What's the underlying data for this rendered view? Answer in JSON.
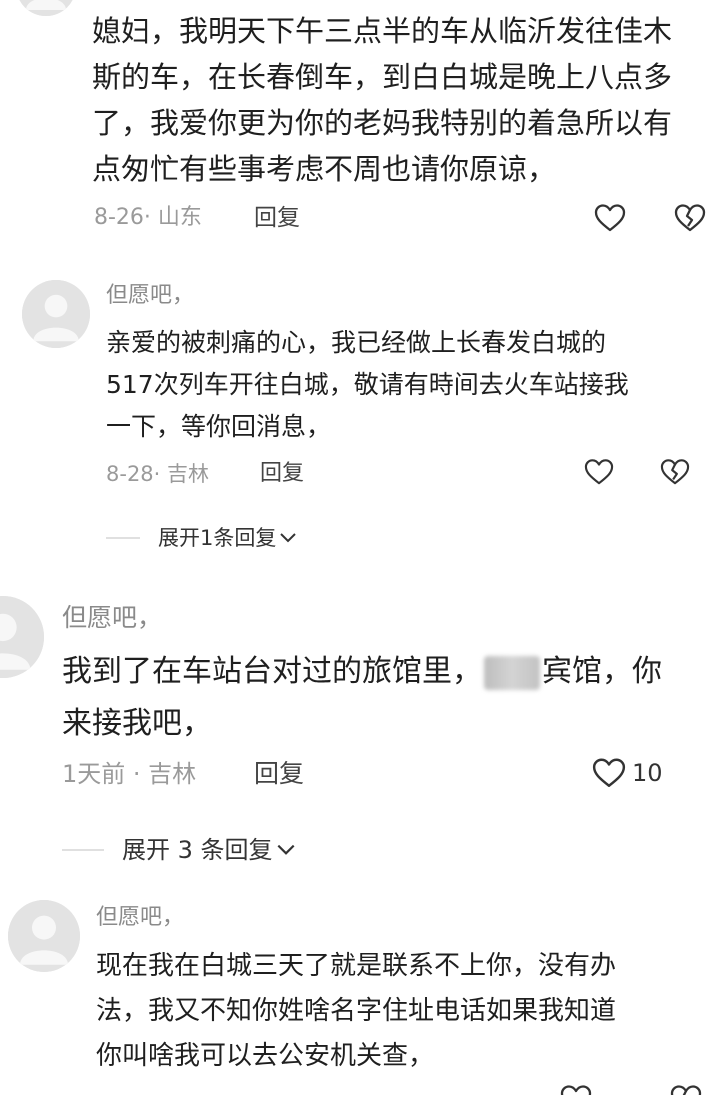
{
  "comments": [
    {
      "username": "",
      "content_lines": [
        "媳妇，我明天下午三点半的车从临沂发往佳木",
        "斯的车，在长春倒车，到白白城是晚上八点多",
        "了，我爱你更为你的老妈我特别的着急所以有",
        "点匆忙有些事考虑不周也请你原谅，"
      ],
      "meta": "8-26· 山东",
      "reply_label": "回复",
      "like_count": ""
    },
    {
      "username": "但愿吧，",
      "content_lines": [
        "亲爱的被刺痛的心，我已经做上长春发白城的",
        "517次列车开往白城，敬请有時间去火车站接我",
        "一下，等你回消息，"
      ],
      "meta": "8-28· 吉林",
      "reply_label": "回复",
      "like_count": "",
      "expand_label": "展开1条回复"
    },
    {
      "username": "但愿吧，",
      "content_lines": [
        "我到了在车站台对过的旅馆里，",
        "宾馆，你",
        "来接我吧，"
      ],
      "meta": "1天前 · 吉林",
      "reply_label": "回复",
      "like_count": "10",
      "expand_label": "展开 3 条回复"
    },
    {
      "username": "但愿吧，",
      "content_lines": [
        "现在我在白城三天了就是联系不上你，没有办",
        "法，我又不知你姓啥名字住址电话如果我知道",
        "你叫啥我可以去公安机关查，"
      ]
    }
  ],
  "icons": {
    "avatar": "default-avatar-icon",
    "like": "heart-outline-icon",
    "dislike": "broken-heart-icon",
    "expand": "chevron-down-icon"
  },
  "colors": {
    "text": "#1f1f1f",
    "muted": "#9a9a9a",
    "avatar_bg": "#e3e3e3",
    "divider": "#e0e0e0"
  }
}
